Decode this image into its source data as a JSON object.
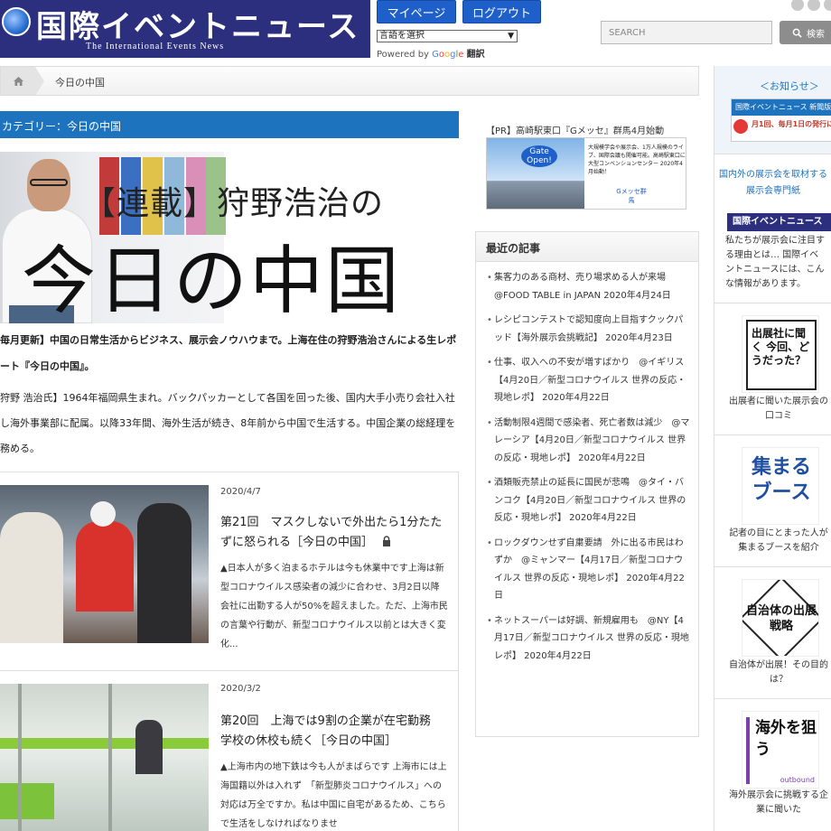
{
  "header": {
    "logo_title": "国際イベントニュース",
    "logo_subtitle": "The International Events News",
    "mypage_label": "マイページ",
    "logout_label": "ログアウト",
    "lang_select_value": "言語を選択",
    "powered_by": "Powered by",
    "google": [
      "G",
      "o",
      "o",
      "g",
      "l",
      "e"
    ],
    "translate": "翻訳",
    "search_placeholder": "SEARCH",
    "search_button": "検索"
  },
  "breadcrumb": {
    "current": "今日の中国"
  },
  "category": {
    "label": "カテゴリー：今日の中国"
  },
  "hero": {
    "line1": "【連載】狩野浩治の",
    "line2": "今日の中国"
  },
  "intro": {
    "bold": "毎月更新】中国の日常生活からビジネス、展示会ノウハウまで。上海在住の狩野浩治さんによる生レポート『今日の中国』。",
    "profile": "狩野 浩治氏】1964年福岡県生まれ。バックパッカーとして各国を回った後、国内大手小売り会社入社し海外事業部に配属。以降33年間、海外生活が続き、8年前から中国で生活する。中国企業の総経理を務める。"
  },
  "articles": [
    {
      "date": "2020/4/7",
      "title": "第21回　マスクしないで外出たら1分たたずに怒られる［今日の中国］",
      "lock_icon": "lock-icon",
      "excerpt": "▲日本人が多く泊まるホテルは今も休業中です上海は新型コロナウイルス感染者の減少に合わせ、3月2日以降会社に出勤する人が50%を超えました。ただ、上海市民の言葉や行動が、新型コロナウイルス以前とは大きく変化..."
    },
    {
      "date": "2020/3/2",
      "title": "第20回　上海では9割の企業が在宅勤務　学校の休校も続く［今日の中国］",
      "excerpt": "▲上海市内の地下鉄は今も人がまばらです 上海市には上海国籍以外は入れず　「新型肺炎コロナウイルス」への対応は万全ですか。私は中国に自宅があるため、こちらで生活をしなければなりませ"
    }
  ],
  "pr": {
    "text": "【PR】高崎駅東口『Gメッセ』群馬4月始動",
    "gate_text": "Gate Open!",
    "banner_copy": "大規模学会や展示会、1万人規模のライブ、国際会議も開催可能。高崎駅東口に大型コンベンションセンター 2020年4月始動！",
    "banner_logo": "Gメッセ群馬"
  },
  "recent": {
    "heading": "最近の記事",
    "items": [
      "集客力のある商材、売り場求める人が来場　@FOOD TABLE in JAPAN 2020年4月24日",
      "レシピコンテストで認知度向上目指すクックパッド【海外展示会挑戦記】 2020年4月23日",
      "仕事、収入への不安が増すばかり　@イギリス【4月20日／新型コロナウイルス 世界の反応・現地レポ】 2020年4月22日",
      "活動制限4週間で感染者、死亡者数は減少　@マレーシア【4月20日／新型コロナウイルス 世界の反応・現地レポ】 2020年4月22日",
      "酒類販売禁止の延長に国民が悲鳴　@タイ・バンコク【4月20日／新型コロナウイルス 世界の反応・現地レポ】 2020年4月22日",
      "ロックダウンせず自粛要請　外に出る市民はわずか　@ミャンマー【4月17日／新型コロナウイルス 世界の反応・現地レポ】 2020年4月22日",
      "ネットスーパーは好調、新規雇用も　@NY【4月17日／新型コロナウイルス 世界の反応・現地レポ】 2020年4月22日"
    ]
  },
  "sidebar": {
    "notice_title": "＜お知らせ＞",
    "mini_banner_bar": "国際イベントニュース 新聞版",
    "mini_banner_text": "月1回、毎月1日の発行に",
    "link_line1": "国内外の展示会を取材する",
    "link_line2": "展示会専門紙",
    "banner2": "国際イベントニュース",
    "about_lines": [
      "私たちが展示会に注目す",
      "る理由とは… 国際イベ",
      "ントニュースには、こん",
      "な情報があります。"
    ],
    "widget1_title": "出展社に聞く 今回、どうだった？",
    "widget1_cap": [
      "出展者に聞いた展示会の",
      "口コミ"
    ],
    "widget2_title": "集まるブース",
    "widget2_cap": [
      "記者の目にとまった人が",
      "集まるブースを紹介"
    ],
    "widget3_title": "自治体の出展戦略",
    "widget3_cap": [
      "自治体が出展！その目的",
      "は？"
    ],
    "widget4_title": "海外を狙う",
    "widget4_sub": "outbound",
    "widget4_cap": [
      "海外展示会に挑戦する企",
      "業に聞いた"
    ]
  },
  "colors": {
    "brand_navy": "#2c2f7e",
    "button_blue": "#1f5fc9",
    "category_blue": "#1e73be"
  }
}
